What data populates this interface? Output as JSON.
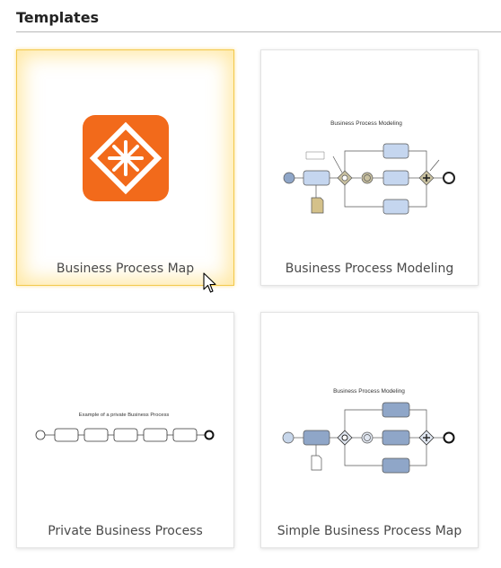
{
  "header": {
    "title": "Templates"
  },
  "templates": [
    {
      "label": "Business Process Map"
    },
    {
      "label": "Business Process Modeling",
      "diagram_title": "Business Process Modeling"
    },
    {
      "label": "Private Business Process",
      "diagram_title": "Example of a private Business Process"
    },
    {
      "label": "Simple Business Process Map",
      "diagram_title": "Business Process Modeling"
    }
  ],
  "colors": {
    "logo": "#f26a1b",
    "selection": "#f2c94c"
  }
}
